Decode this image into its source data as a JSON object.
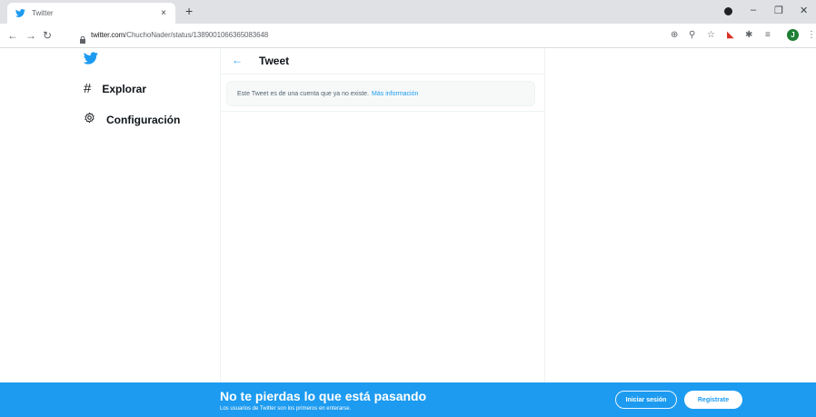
{
  "browser": {
    "tab_title": "Twitter",
    "tab_close": "×",
    "new_tab": "+",
    "url_host": "twitter.com",
    "url_path": "/ChuchoNader/status/1389001066365083648",
    "avatar_letter": "J"
  },
  "sidebar": {
    "items": [
      {
        "label": "Explorar",
        "icon": "hashtag-icon"
      },
      {
        "label": "Configuración",
        "icon": "gear-icon"
      }
    ]
  },
  "main": {
    "header_title": "Tweet",
    "back_arrow": "←",
    "notice_text": "Este Tweet es de una cuenta que ya no existe.",
    "notice_link": "Más información"
  },
  "banner": {
    "title": "No te pierdas lo que está pasando",
    "subtitle": "Los usuarios de Twitter son los primeros en enterarse.",
    "login_label": "Iniciar sesión",
    "signup_label": "Regístrate"
  },
  "colors": {
    "accent": "#1d9bf0",
    "chrome_tabbar": "#dfe1e5"
  }
}
